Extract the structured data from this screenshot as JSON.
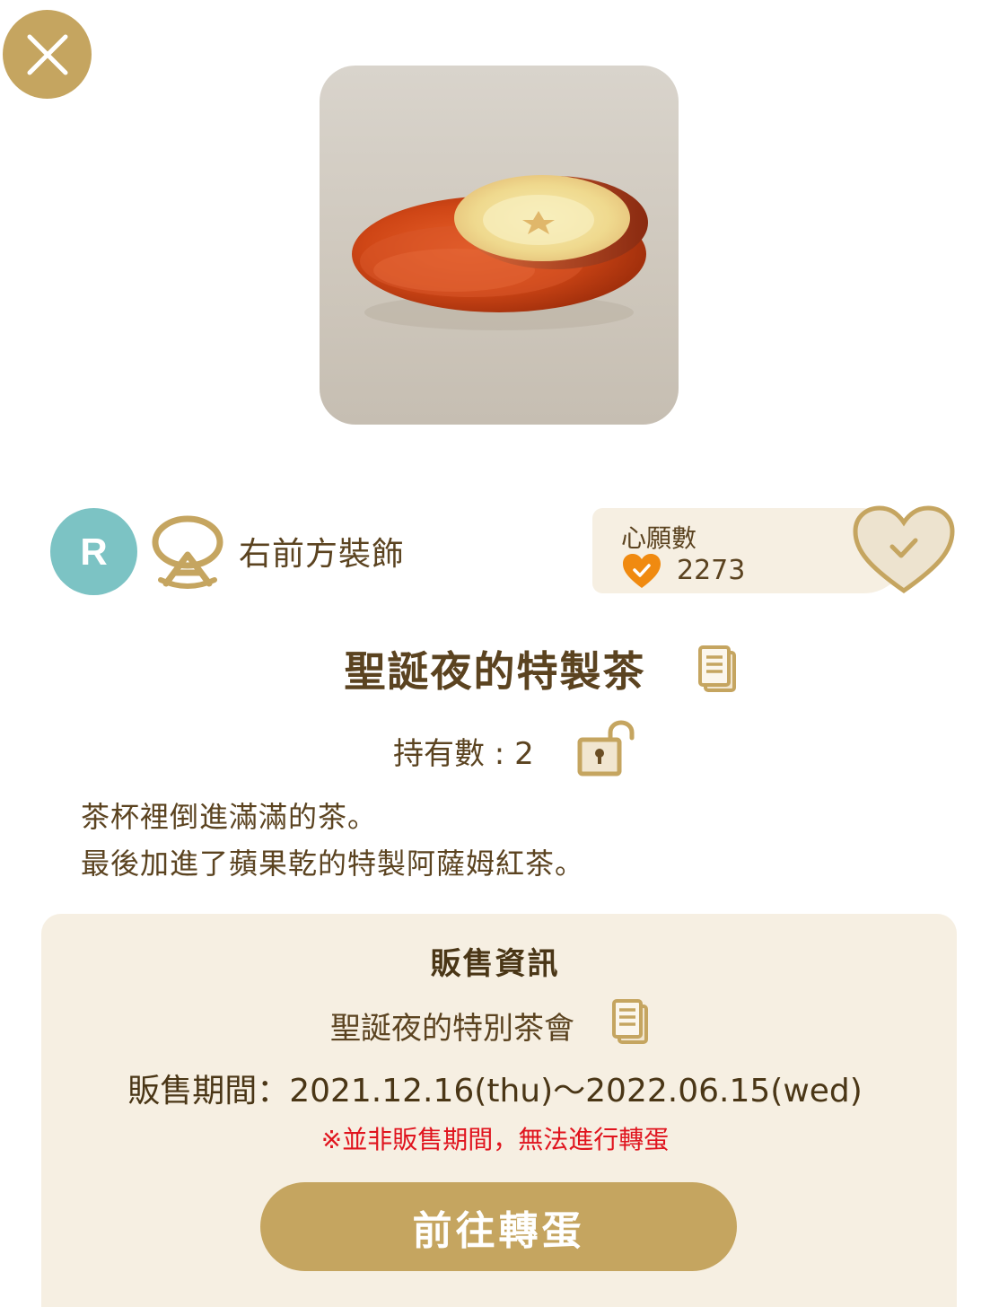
{
  "header": {
    "close_icon": "close-icon"
  },
  "item": {
    "image_icon": "apple-tea-item-image",
    "rarity": "R",
    "category_icon": "head-accessory-icon",
    "category": "右前方裝飾",
    "title": "聖誕夜的特製茶",
    "owned_label": "持有數 : 2",
    "description_lines": [
      "茶杯裡倒進滿滿的茶。",
      "最後加進了蘋果乾的特製阿薩姆紅茶。"
    ]
  },
  "wishlist": {
    "label": "心願數",
    "count": "2273",
    "heart_icon": "heart-check-icon",
    "button_icon": "heart-check-outline-icon"
  },
  "sales": {
    "heading": "販售資訊",
    "event_name": "聖誕夜的特別茶會",
    "period": "販售期間：2021.12.16(thu)〜2022.06.15(wed)",
    "warning": "※並非販售期間，無法進行轉蛋",
    "button_label": "前往轉蛋"
  },
  "colors": {
    "accent_gold": "#c5a560",
    "text_brown": "#5b4320",
    "panel_bg": "#f6efe2",
    "rarity_teal": "#7cc3c4",
    "warning_red": "#e0141e",
    "heart_orange": "#f08a10"
  }
}
